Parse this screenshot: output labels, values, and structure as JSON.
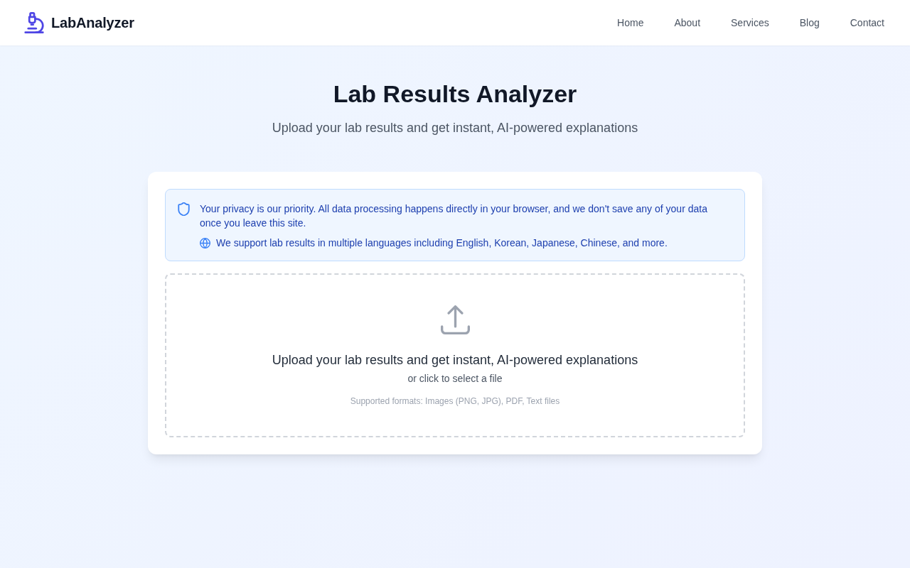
{
  "header": {
    "logo": {
      "text": "LabAnalyzer"
    },
    "nav": [
      {
        "label": "Home"
      },
      {
        "label": "About"
      },
      {
        "label": "Services"
      },
      {
        "label": "Blog"
      },
      {
        "label": "Contact"
      }
    ]
  },
  "hero": {
    "title": "Lab Results Analyzer",
    "subtitle": "Upload your lab results and get instant, AI-powered explanations"
  },
  "notice": {
    "privacy": "Your privacy is our priority. All data processing happens directly in your browser, and we don't save any of your data once you leave this site.",
    "languages": "We support lab results in multiple languages including English, Korean, Japanese, Chinese, and more."
  },
  "dropzone": {
    "title": "Upload your lab results and get instant, AI-powered explanations",
    "hint": "or click to select a file",
    "formats": "Supported formats: Images (PNG, JPG), PDF, Text files"
  }
}
